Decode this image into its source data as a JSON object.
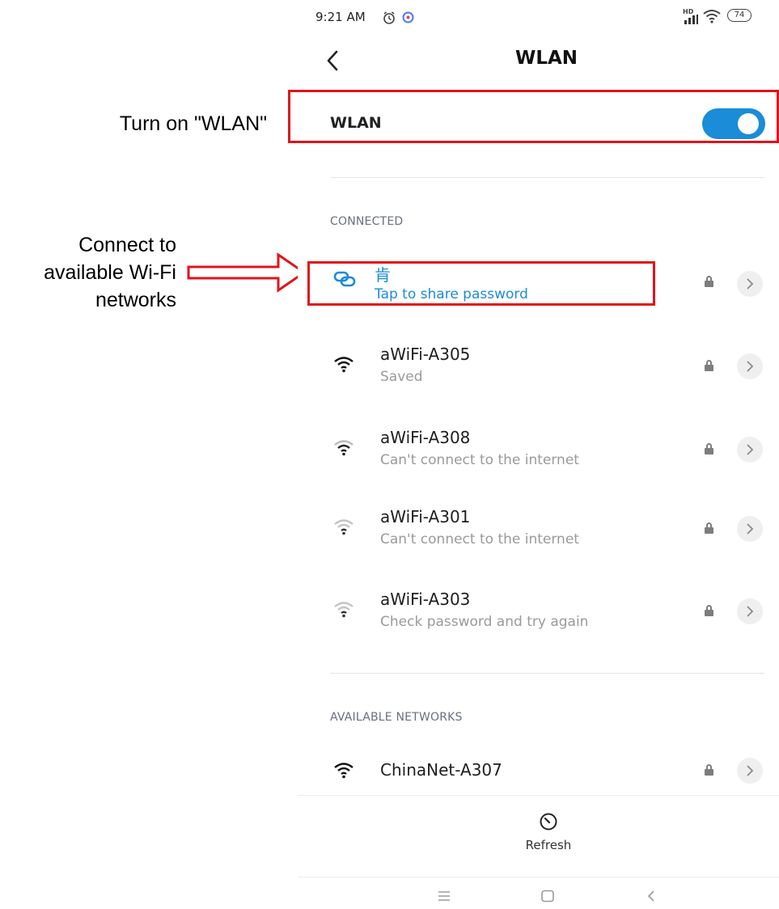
{
  "annotations": {
    "turn_on": "Turn on \"WLAN\"",
    "connect_line1": "Connect to",
    "connect_line2": "available Wi-Fi",
    "connect_line3": "networks"
  },
  "status_bar": {
    "time": "9:21 AM",
    "battery": "74",
    "network_badge": "HD"
  },
  "header": {
    "title": "WLAN",
    "back_icon": "chevron-left-icon"
  },
  "wlan_toggle": {
    "label": "WLAN",
    "state": "on"
  },
  "connected": {
    "section_title": "CONNECTED",
    "current": {
      "name": "肯",
      "subtitle": "Tap to share password",
      "color": "#1a8cd8"
    },
    "saved_networks": [
      {
        "name": "aWiFi-A305",
        "status": "Saved",
        "signal": "strong"
      },
      {
        "name": "aWiFi-A308",
        "status": "Can't connect to the internet",
        "signal": "medium"
      },
      {
        "name": "aWiFi-A301",
        "status": "Can't connect to the internet",
        "signal": "weak"
      },
      {
        "name": "aWiFi-A303",
        "status": "Check password and try again",
        "signal": "weak"
      }
    ]
  },
  "available": {
    "section_title": "AVAILABLE NETWORKS",
    "networks": [
      {
        "name": "ChinaNet-A307",
        "signal": "strong"
      }
    ]
  },
  "footer": {
    "refresh_label": "Refresh"
  },
  "colors": {
    "accent": "#1a8cd8",
    "highlight": "#e0141c",
    "toggle": "#1a8cd8"
  }
}
